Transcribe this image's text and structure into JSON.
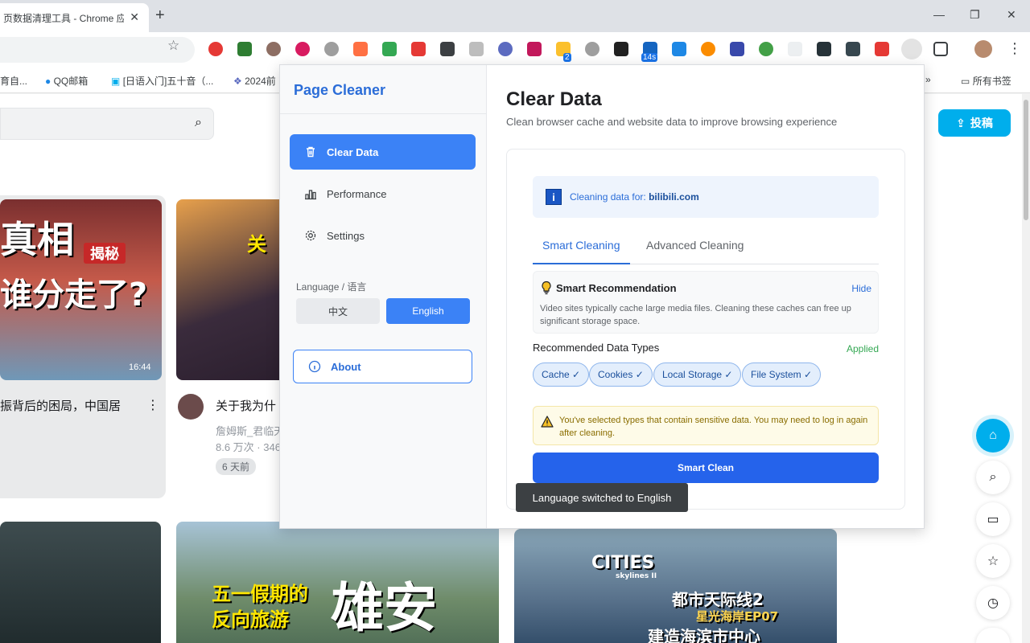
{
  "browser": {
    "tab_title": "页数据清理工具 - Chrome 应",
    "tab_close": "✕",
    "new_tab": "+",
    "window_controls": [
      "—",
      "❐",
      "✕"
    ],
    "extension_badges": [
      "2",
      "14s"
    ],
    "bookmarks": [
      "育自...",
      "QQ邮箱",
      "[日语入门]五十音（...",
      "2024前",
      "»",
      "所有书签"
    ]
  },
  "page": {
    "upload_label": "投稿",
    "thumb1_text_line1": "真相",
    "thumb1_text_badge": "揭秘",
    "thumb1_text_line2": "谁分走了?",
    "thumb1_duration": "16:44",
    "video1_title": "振背后的困局，中国居",
    "video1_more": "⋮",
    "thumb2_text": "关",
    "video2_title": "关于我为什",
    "video2_author": "詹姆斯_君临天",
    "video2_stats": "8.6 万次 · 346",
    "video2_date": "6 天前",
    "thumb4_text_a": "五一假期的",
    "thumb4_text_b": "反向旅游",
    "thumb4_text_c": "雄安",
    "thumb5_brand": "CITIES",
    "thumb5_brand_sub": "skylines II",
    "thumb5_text_a": "都市天际线2",
    "thumb5_text_b": "星光海岸EP07",
    "thumb5_text_c": "建造海滨市中心"
  },
  "popup": {
    "brand": "Page Cleaner",
    "nav": {
      "clear_data": "Clear Data",
      "performance": "Performance",
      "settings": "Settings"
    },
    "language": {
      "label": "Language / 语言",
      "zh": "中文",
      "en": "English"
    },
    "about": "About",
    "main": {
      "title": "Clear Data",
      "subtitle": "Clean browser cache and website data to improve browsing experience",
      "domain_prefix": "Cleaning data for:",
      "domain": "bilibili.com",
      "tab_smart": "Smart Cleaning",
      "tab_advanced": "Advanced Cleaning",
      "reco_title": "Smart Recommendation",
      "reco_hide": "Hide",
      "reco_text": "Video sites typically cache large media files. Cleaning these caches can free up significant storage space.",
      "rdt_label": "Recommended Data Types",
      "rdt_applied": "Applied",
      "tags": [
        "Cache ✓",
        "Cookies ✓",
        "Local Storage ✓",
        "File System ✓"
      ],
      "warning": "You've selected types that contain sensitive data. You may need to log in again after cleaning.",
      "smart_clean": "Smart Clean"
    }
  },
  "toast": "Language switched to English",
  "colors": {
    "accent": "#3b82f6",
    "brand": "#2b6dd8",
    "primary_button": "#2563eb",
    "bilibili_blue": "#00aeec"
  }
}
